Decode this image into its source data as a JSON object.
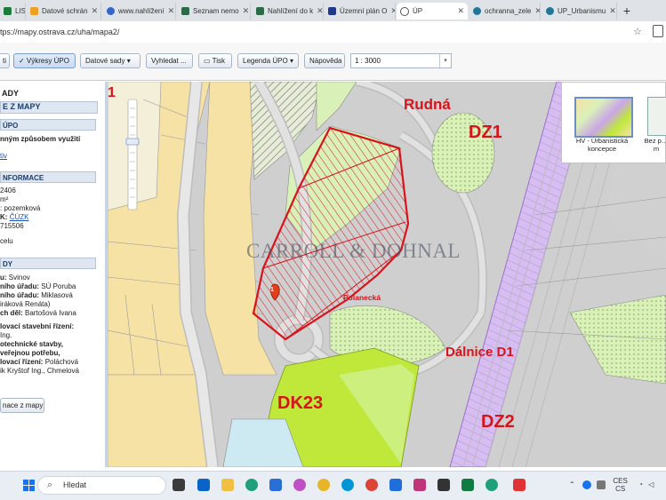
{
  "tabs": [
    {
      "label": "LIST",
      "fav": "#1e7b3a",
      "icon": "sheet-icon"
    },
    {
      "label": "Datové schrán",
      "fav": "#f0a020",
      "icon": "databox-icon"
    },
    {
      "label": "www.nahlížení",
      "fav": "#3366cc",
      "icon": "search-favicon"
    },
    {
      "label": "Seznam nemo",
      "fav": "#2b6b47",
      "icon": "cadastre-icon"
    },
    {
      "label": "Nahlížení do k",
      "fav": "#2b6b47",
      "icon": "cadastre-icon"
    },
    {
      "label": "Územní plán O",
      "fav": "#1e3a8a",
      "icon": "grid-icon"
    },
    {
      "label": "ÚP",
      "fav": "#555555",
      "icon": "globe-icon"
    },
    {
      "label": "ochranna_zele",
      "fav": "#21759b",
      "icon": "wordpress-icon"
    },
    {
      "label": "UP_Urbanismu",
      "fav": "#21759b",
      "icon": "wordpress-icon"
    }
  ],
  "address": {
    "url": "tps://mapy.ostrava.cz/uha/mapa2/"
  },
  "toolbar": {
    "first": "ti",
    "vykresy": "✓ Výkresy ÚPO",
    "datove": "Datové sady",
    "vyhledat": "Vyhledat ...",
    "tisk": "Tisk",
    "legenda": "Legenda ÚPO",
    "napoveda": "Nápověda",
    "scale": "1 : 3000"
  },
  "panel": {
    "title": "ADY",
    "subtitle": "E Z MAPY",
    "sec1": "ÚPO",
    "l1": "nným způsobem využití",
    "l2": "tiv",
    "sec2": "NFORMACE",
    "l3": "2406",
    "l4": "m²",
    "l5": ": pozemková",
    "l6a": "K:",
    "l6b": "ČÚZK",
    "l7": "715506",
    "l8": "celu",
    "sec3": "DY",
    "m1a": "u:",
    "m1b": "Svinov",
    "m2a": "ního úřadu:",
    "m2b": "SÚ Poruba",
    "m3a": "ního úřadu:",
    "m3b": "Miklasová",
    "m4": "iráková Renáta)",
    "m5a": "ch děl:",
    "m5b": "Bartošová Ivana",
    "m6": "lovací stavební řízení:",
    "m7": "Ing.",
    "m8": "otechnické stavby,",
    "m9": "veřejnou potřebu,",
    "m10a": "lovací řízení:",
    "m10b": "Poláchová",
    "m11": "ik Kryštof Ing., Chmelová",
    "button": "nace z mapy"
  },
  "map": {
    "labels": {
      "rudna": "Rudná",
      "dz1": "DZ1",
      "dz2": "DZ2",
      "dk23": "DK23",
      "dalnice": "Dálnice D1",
      "polanecka": "Polanecká",
      "watermark": "CARROLL & DOHNAL",
      "marker": "1",
      "corner": "1"
    },
    "layers": [
      {
        "caption": "HV - Urbanistická koncepce"
      },
      {
        "caption": "Bez p… m"
      }
    ],
    "colors": {
      "red": "#d8131b",
      "label_red": "#d8131b",
      "green": "#bfe83a",
      "lightgreen": "#d9f0b8",
      "yellow": "#f7e2a6",
      "purple": "#c9a6e8",
      "road": "#c8c8c8"
    }
  },
  "taskbar": {
    "search": "Hledat",
    "lang1": "CES",
    "lang2": "CS"
  }
}
